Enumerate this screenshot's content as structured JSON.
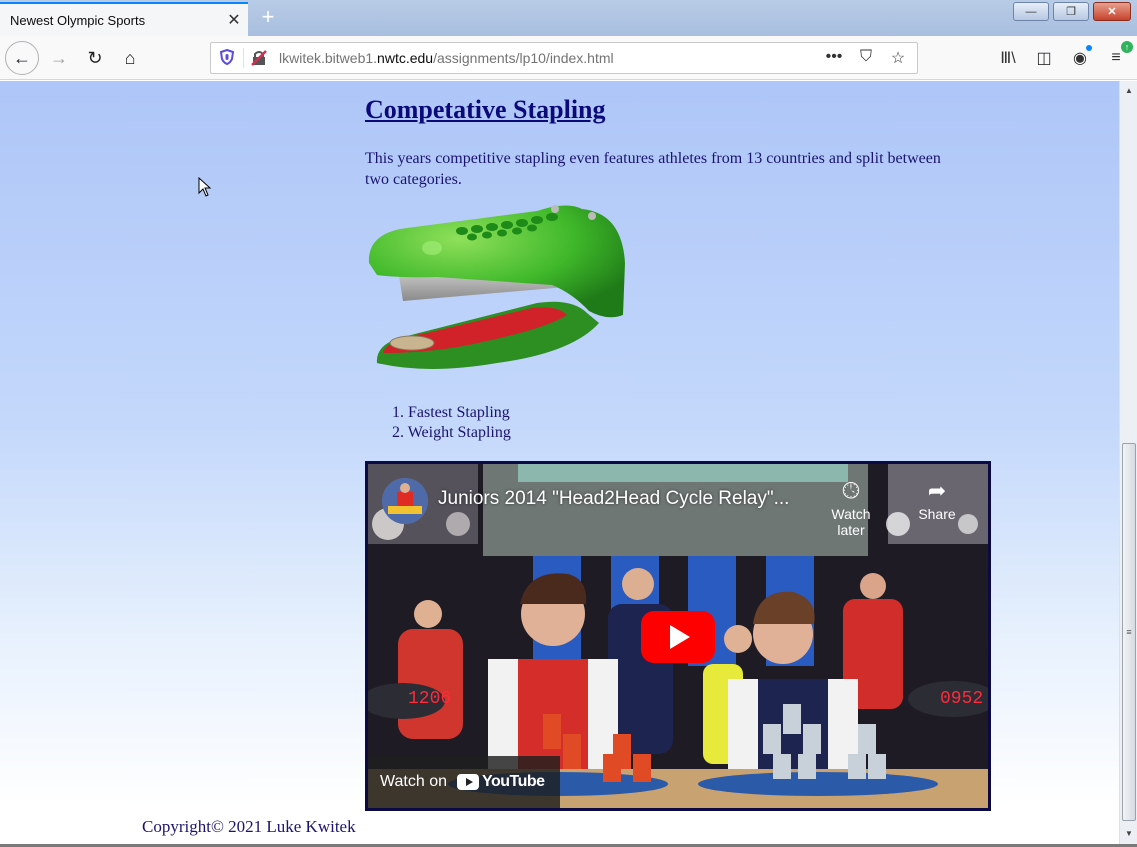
{
  "browser": {
    "tab": {
      "title": "Newest Olympic Sports",
      "close_icon": "close-icon"
    },
    "new_tab_label": "+",
    "window_controls": {
      "minimize": "—",
      "restore": "❐",
      "close": "✕"
    },
    "nav": {
      "back": "←",
      "forward": "→",
      "reload": "↻",
      "home": "⌂"
    },
    "url": {
      "prefix": "lkwitek.bitweb1.",
      "domain": "nwtc.edu",
      "path": "/assignments/lp10/index.html"
    },
    "url_actions": {
      "more": "•••",
      "pocket": "⛉",
      "bookmark": "☆"
    },
    "toolbar": {
      "library": "Ⅲ\\",
      "sidebar": "◫",
      "account": "◉",
      "menu": "≡",
      "update": "↑"
    }
  },
  "page": {
    "heading": "Competative Stapling",
    "intro": "This years competitive stapling even features athletes from 13 countries and split between two categories.",
    "stapler_image_alt": "Green crocodile-shaped stapler",
    "categories": [
      {
        "number": "1.",
        "label": "Fastest Stapling"
      },
      {
        "number": "2.",
        "label": "Weight Stapling"
      }
    ],
    "video": {
      "title": "Juniors 2014 \"Head2Head Cycle Relay\"...",
      "watch_later": "Watch later",
      "share": "Share",
      "watch_on": "Watch on",
      "youtube": "YouTube",
      "timer_left": "1206",
      "timer_right": "0952",
      "accent_color": "#ff0000"
    },
    "footer": "Copyright© 2021 Luke Kwitek"
  },
  "scrollbar": {
    "thumb_grip": "≡",
    "up": "▲",
    "down": "▼",
    "position_fraction": 0.57
  }
}
